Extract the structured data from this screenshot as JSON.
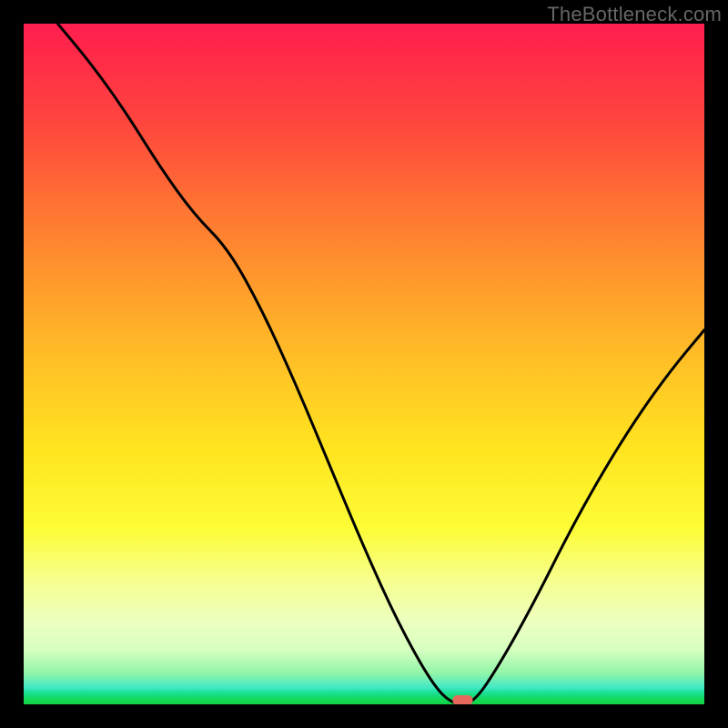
{
  "watermark": "TheBottleneck.com",
  "chart_data": {
    "type": "line",
    "title": "",
    "xlabel": "",
    "ylabel": "",
    "xlim": [
      0,
      100
    ],
    "ylim": [
      0,
      100
    ],
    "grid": false,
    "background_gradient": {
      "orientation": "vertical",
      "colors": [
        "#FF1F50",
        "#FF7033",
        "#FFE31F",
        "#F6FF90",
        "#43E8C5",
        "#10D543"
      ],
      "stops_pct": [
        0,
        26,
        62,
        82,
        97.5,
        100
      ]
    },
    "series": [
      {
        "name": "curve",
        "x": [
          5,
          10,
          15,
          20,
          25,
          30,
          35,
          40,
          45,
          50,
          55,
          60,
          63,
          66,
          70,
          75,
          80,
          85,
          90,
          95,
          100
        ],
        "values": [
          100,
          94,
          87,
          79,
          72,
          67,
          58,
          47,
          35,
          23,
          12,
          3,
          0,
          0,
          6,
          15,
          25,
          34,
          42,
          49,
          55
        ]
      }
    ],
    "notch": {
      "x_pct": 64.5,
      "y_pct": 0,
      "color": "#E6695C"
    }
  },
  "frame": {
    "border_left": 26,
    "border_top": 26,
    "border_right": 26,
    "border_bottom": 26
  }
}
